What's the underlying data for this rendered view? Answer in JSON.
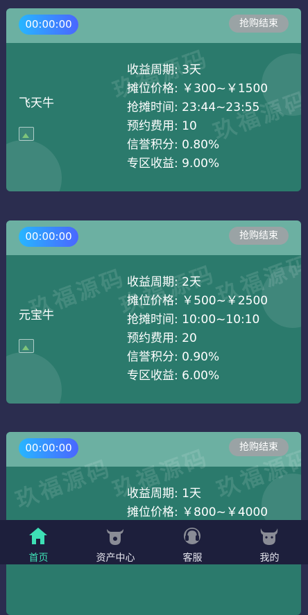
{
  "cards": [
    {
      "timer": "00:00:00",
      "status": "抢购结束",
      "name": "飞天牛",
      "details": [
        {
          "label": "收益周期:",
          "value": "3天"
        },
        {
          "label": "摊位价格:",
          "value": "￥300~￥1500"
        },
        {
          "label": "抢摊时间:",
          "value": "23:44~23:55"
        },
        {
          "label": "预约费用:",
          "value": "10"
        },
        {
          "label": "信誉积分:",
          "value": "0.80%"
        },
        {
          "label": "专区收益:",
          "value": "9.00%"
        }
      ]
    },
    {
      "timer": "00:00:00",
      "status": "抢购结束",
      "name": "元宝牛",
      "details": [
        {
          "label": "收益周期:",
          "value": "2天"
        },
        {
          "label": "摊位价格:",
          "value": "￥500~￥2500"
        },
        {
          "label": "抢摊时间:",
          "value": "10:00~10:10"
        },
        {
          "label": "预约费用:",
          "value": "20"
        },
        {
          "label": "信誉积分:",
          "value": "0.90%"
        },
        {
          "label": "专区收益:",
          "value": "6.00%"
        }
      ]
    },
    {
      "timer": "00:00:00",
      "status": "抢购结束",
      "name": "",
      "details": [
        {
          "label": "收益周期:",
          "value": "1天"
        },
        {
          "label": "摊位价格:",
          "value": "￥800~￥4000"
        }
      ]
    }
  ],
  "watermark": "玖福源码",
  "tabbar": {
    "items": [
      {
        "label": "首页",
        "icon": "home-icon",
        "active": true
      },
      {
        "label": "资产中心",
        "icon": "cow-icon",
        "active": false
      },
      {
        "label": "客服",
        "icon": "headset-icon",
        "active": false
      },
      {
        "label": "我的",
        "icon": "profile-cow-icon",
        "active": false
      }
    ]
  },
  "colors": {
    "page_bg": "#2b2d4f",
    "card_bg": "#2b7a6c",
    "card_header": "#6cb0a2",
    "timer_gradient_start": "#27b6ff",
    "timer_gradient_end": "#4a66ff",
    "status_bg": "#9aa3a5",
    "tabbar_bg": "#1d1f3c",
    "active_tab": "#3ee0b5"
  }
}
